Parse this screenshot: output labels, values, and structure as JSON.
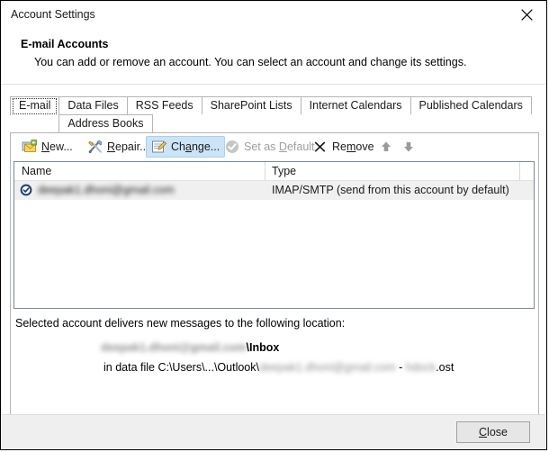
{
  "window": {
    "title": "Account Settings",
    "close_icon": "close-icon"
  },
  "header": {
    "title": "E-mail Accounts",
    "subtitle": "You can add or remove an account. You can select an account and change its settings."
  },
  "tabs": [
    {
      "label": "E-mail",
      "selected": true
    },
    {
      "label": "Data Files",
      "selected": false
    },
    {
      "label": "RSS Feeds",
      "selected": false
    },
    {
      "label": "SharePoint Lists",
      "selected": false
    },
    {
      "label": "Internet Calendars",
      "selected": false
    },
    {
      "label": "Published Calendars",
      "selected": false
    },
    {
      "label": "Address Books",
      "selected": false
    }
  ],
  "toolbar": {
    "new": {
      "label": "New...",
      "icon": "new-mail-icon",
      "state": "enabled"
    },
    "repair": {
      "label": "Repair...",
      "icon": "repair-tools-icon",
      "state": "enabled"
    },
    "change": {
      "label": "Change...",
      "icon": "change-account-icon",
      "state": "hover"
    },
    "set_default": {
      "label": "Set as Default",
      "icon": "check-circle-icon",
      "state": "disabled"
    },
    "remove": {
      "label": "Remove",
      "icon": "x-icon",
      "state": "enabled"
    },
    "move_up": {
      "icon": "arrow-up-icon",
      "state": "disabled"
    },
    "move_down": {
      "icon": "arrow-down-icon",
      "state": "disabled"
    }
  },
  "accounts_list": {
    "columns": [
      "Name",
      "Type"
    ],
    "rows": [
      {
        "name": "deepak1.dhoni@gmail.com",
        "name_redacted": true,
        "default_badge": "default-account-icon",
        "type": "IMAP/SMTP (send from this account by default)",
        "selected": true
      }
    ]
  },
  "delivery": {
    "label": "Selected account delivers new messages to the following location:",
    "location_account": "deepak1.dhoni@gmail.com",
    "location_folder": "\\Inbox",
    "datafile_prefix": "in data file C:\\Users\\...\\Outlook\\",
    "datafile_account": "deepak1.dhoni@gmail.com",
    "datafile_separator": " - ",
    "datafile_name": "hdock",
    "datafile_extension": ".ost"
  },
  "footer": {
    "close_label": "Close",
    "close_accesskey": "C"
  },
  "colors": {
    "hover_fill": "#cce4f7",
    "hover_border": "#a9d0ef",
    "row_selected": "#f0f0f0",
    "badge_blue": "#1f3f73",
    "footer_bg": "#efefef",
    "panel_border": "#b5b5b5",
    "list_border": "#7a8a99"
  }
}
